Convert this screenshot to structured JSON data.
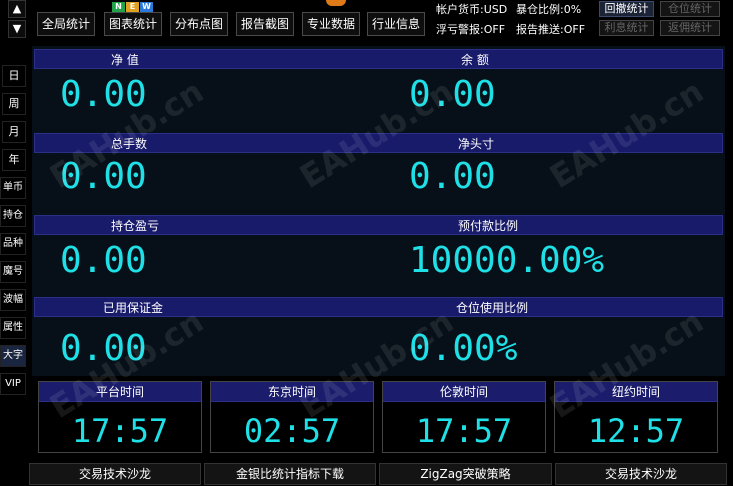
{
  "toolbar": {
    "buttons": [
      "全局统计",
      "图表统计",
      "分布点图",
      "报告截图",
      "专业数据",
      "行业信息"
    ],
    "badges": [
      "N",
      "E",
      "W"
    ]
  },
  "status": {
    "currency": "帐户货币:USD",
    "margin_warning": "浮亏警报:OFF",
    "blowup_ratio": "暴仓比例:0%",
    "report_push": "报告推送:OFF",
    "btn_drawdown": "回撤统计",
    "btn_position": "仓位统计",
    "btn_interest": "利息统计",
    "btn_rebate": "返佣统计"
  },
  "sidebar": {
    "arrow_up": "▲",
    "arrow_down": "▼",
    "items": [
      "日",
      "周",
      "月",
      "年",
      "单币",
      "持仓",
      "品种",
      "魔号",
      "波幅",
      "属性",
      "大字",
      "VIP"
    ]
  },
  "stats": {
    "net_value_label": "净 值",
    "net_value": "0.00",
    "balance_label": "余 额",
    "balance": "0.00",
    "total_lots_label": "总手数",
    "total_lots": "0.00",
    "net_position_label": "净头寸",
    "net_position": "0.00",
    "floating_pl_label": "持仓盈亏",
    "floating_pl": "0.00",
    "prepay_ratio_label": "预付款比例",
    "prepay_ratio": "10000.00%",
    "used_margin_label": "已用保证金",
    "used_margin": "0.00",
    "position_ratio_label": "仓位使用比例",
    "position_ratio": "0.00%"
  },
  "clocks": [
    {
      "label": "平台时间",
      "time": "17:57"
    },
    {
      "label": "东京时间",
      "time": "02:57"
    },
    {
      "label": "伦敦时间",
      "time": "17:57"
    },
    {
      "label": "纽约时间",
      "time": "12:57"
    }
  ],
  "bottom_links": [
    "交易技术沙龙",
    "金银比统计指标下载",
    "ZigZag突破策略",
    "交易技术沙龙"
  ],
  "watermark": "EAHub.cn",
  "colors": {
    "value": "#1fe0e6",
    "header_bg": "#181a6a",
    "panel_bg": "#071018"
  }
}
